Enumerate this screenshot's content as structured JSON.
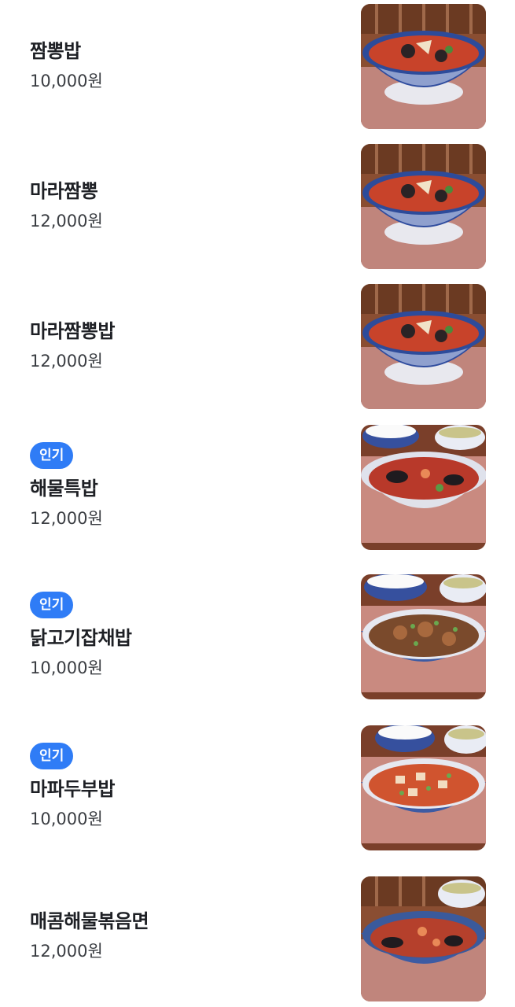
{
  "menu_items": [
    {
      "name": "짬뽕밥",
      "price": "10,000원",
      "badge": "",
      "image": "jjamppong-rice-bowl"
    },
    {
      "name": "마라짬뽕",
      "price": "12,000원",
      "badge": "",
      "image": "mala-jjamppong-bowl"
    },
    {
      "name": "마라짬뽕밥",
      "price": "12,000원",
      "badge": "",
      "image": "mala-jjamppong-rice-bowl"
    },
    {
      "name": "해물특밥",
      "price": "12,000원",
      "badge": "인기",
      "image": "seafood-special-rice"
    },
    {
      "name": "닭고기잡채밥",
      "price": "10,000원",
      "badge": "인기",
      "image": "chicken-japchae-rice"
    },
    {
      "name": "마파두부밥",
      "price": "10,000원",
      "badge": "인기",
      "image": "mapo-tofu-rice"
    },
    {
      "name": "매콤해물볶음면",
      "price": "12,000원",
      "badge": "",
      "image": "spicy-seafood-stirfried-noodles"
    }
  ],
  "colors": {
    "badge": "#2f7cf6",
    "text": "#1e2025",
    "price": "#3a3d42"
  }
}
